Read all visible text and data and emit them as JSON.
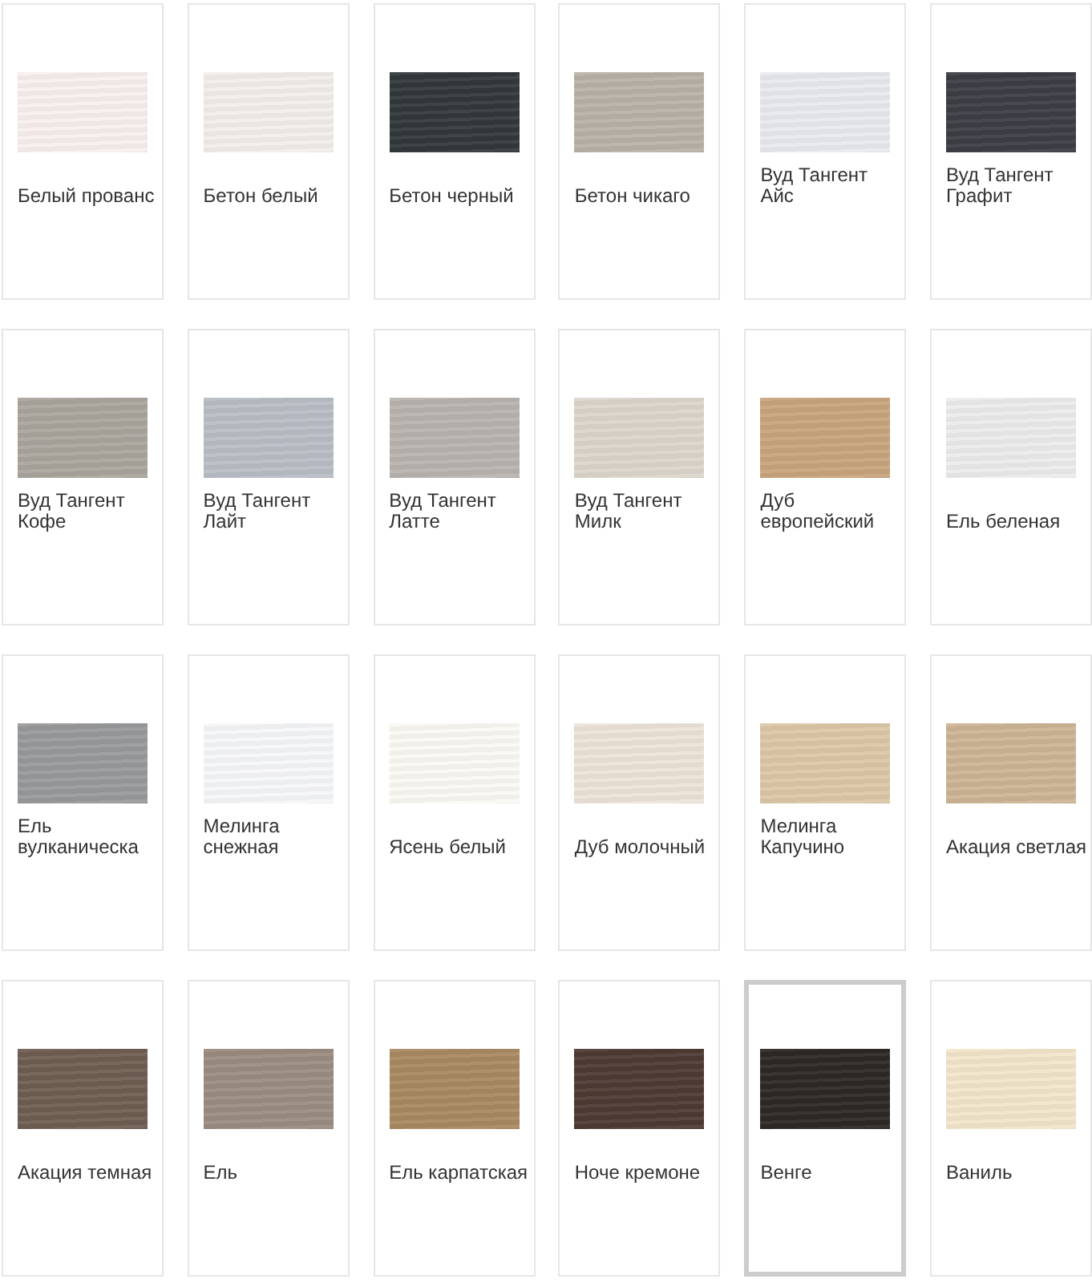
{
  "finishes": [
    {
      "name": "Белый прованс",
      "color": "#f8f0ee",
      "selected": false
    },
    {
      "name": "Бетон белый",
      "color": "#f2eeea",
      "selected": false
    },
    {
      "name": "Бетон черный",
      "color": "#33393b",
      "selected": false
    },
    {
      "name": "Бетон чикаго",
      "color": "#b9b2a8",
      "selected": false
    },
    {
      "name": "Вуд Тангент Айс",
      "color": "#e8eaee",
      "selected": false
    },
    {
      "name": "Вуд Тангент Графит",
      "color": "#3d3d45",
      "selected": false
    },
    {
      "name": "Вуд Тангент Кофе",
      "color": "#aaa69e",
      "selected": false
    },
    {
      "name": "Вуд Тангент Лайт",
      "color": "#b9bec6",
      "selected": false
    },
    {
      "name": "Вуд Тангент Латте",
      "color": "#bab4b0",
      "selected": false
    },
    {
      "name": "Вуд Тангент Милк",
      "color": "#ddd6cc",
      "selected": false
    },
    {
      "name": "Дуб европейский",
      "color": "#c9a57e",
      "selected": false
    },
    {
      "name": "Ель беленая",
      "color": "#ececec",
      "selected": false
    },
    {
      "name": "Ель вулканическа",
      "color": "#999a9c",
      "selected": false
    },
    {
      "name": "Мелинга снежная",
      "color": "#f6f7f9",
      "selected": false
    },
    {
      "name": "Ясень белый",
      "color": "#fbf9f3",
      "selected": false
    },
    {
      "name": "Дуб молочный",
      "color": "#ece4d8",
      "selected": false
    },
    {
      "name": "Мелинга Капучино",
      "color": "#dcc8a8",
      "selected": false
    },
    {
      "name": "Акация светлая",
      "color": "#cdb596",
      "selected": false
    },
    {
      "name": "Акация темная",
      "color": "#6f5e52",
      "selected": false
    },
    {
      "name": "Ель",
      "color": "#9b8c80",
      "selected": false
    },
    {
      "name": "Ель карпатская",
      "color": "#a98a62",
      "selected": false
    },
    {
      "name": "Ноче кремоне",
      "color": "#4e3a33",
      "selected": false
    },
    {
      "name": "Венге",
      "color": "#2e2825",
      "selected": true
    },
    {
      "name": "Ваниль",
      "color": "#f2e6cc",
      "selected": false
    }
  ]
}
